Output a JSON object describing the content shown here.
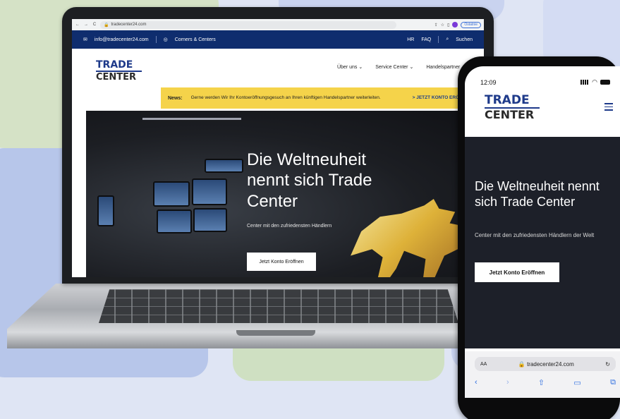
{
  "browser": {
    "url": "tradecenter24.com",
    "continue_label": "Ostatnie",
    "avatar_letter": "S",
    "back_icon": "←",
    "forward_icon": "→",
    "reload_icon": "C"
  },
  "site_top": {
    "email": "info@tradecenter24.com",
    "locations": "Corners & Centers",
    "lang": "HR",
    "faq": "FAQ",
    "search": "Suchen"
  },
  "logo": {
    "line1": "TRADE",
    "line2": "CENTER"
  },
  "menu": [
    "Über uns",
    "Service Center",
    "Handelspartner"
  ],
  "news": {
    "label": "News:",
    "text": "Gerne werden Wir Ihr Kontoeröffnungsgesuch an Ihren künftigen Handelspartner weiterleiten.",
    "cta": "> JETZT KONTO ERÖFFNEN"
  },
  "hero": {
    "title": "Die Weltneuheit nennt sich Trade Center",
    "subtitle": "Center mit den zufriedensten Händlern",
    "button": "Jetzt Konto Eröffnen"
  },
  "phone": {
    "time": "12:09",
    "title": "Die Weltneuheit nennt sich Trade Center",
    "subtitle": "Center mit den zufriedensten Händlern der Welt",
    "button": "Jetzt Konto Eröffnen",
    "safari": {
      "aa": "AA",
      "domain": "tradecenter24.com"
    }
  },
  "colors": {
    "brand_navy": "#0f2d6e",
    "news_yellow": "#f5d34a",
    "hero_dark": "#1d2029"
  }
}
